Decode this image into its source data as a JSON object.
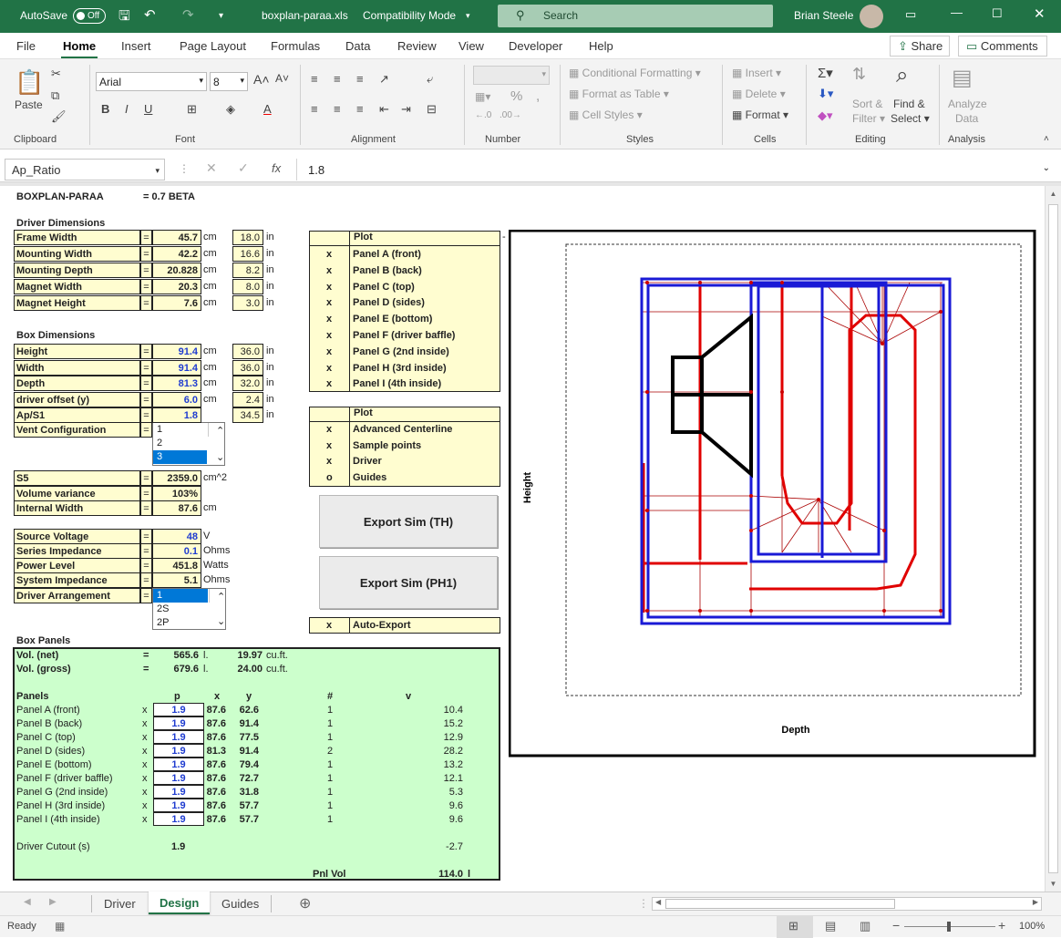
{
  "titlebar": {
    "autosave": "AutoSave",
    "autosave_state": "Off",
    "filename": "boxplan-paraa.xls",
    "mode": "Compatibility Mode",
    "search": "Search",
    "user": "Brian Steele"
  },
  "tabs": [
    "File",
    "Home",
    "Insert",
    "Page Layout",
    "Formulas",
    "Data",
    "Review",
    "View",
    "Developer",
    "Help"
  ],
  "share": "Share",
  "comments": "Comments",
  "ribbon": {
    "paste": "Paste",
    "clipboard": "Clipboard",
    "font_name": "Arial",
    "font_size": "8",
    "font": "Font",
    "alignment": "Alignment",
    "number": "Number",
    "cond_fmt": "Conditional Formatting",
    "fmt_table": "Format as Table",
    "cell_styles": "Cell Styles",
    "styles": "Styles",
    "insert": "Insert",
    "delete": "Delete",
    "format": "Format",
    "cells": "Cells",
    "sort1": "Sort &",
    "sort2": "Filter",
    "find1": "Find &",
    "find2": "Select",
    "editing": "Editing",
    "analyze1": "Analyze",
    "analyze2": "Data",
    "analysis": "Analysis"
  },
  "formula": {
    "namebox": "Ap_Ratio",
    "fx": "fx",
    "value": "1.8"
  },
  "sheet": {
    "title": "BOXPLAN-PARAA",
    "version": "=  0.7 BETA",
    "driver_dims_title": "Driver Dimensions",
    "driver_dims": [
      {
        "label": "Frame Width",
        "eq": "=",
        "val": "45.7",
        "unit": "cm",
        "in": "18.0",
        "inu": "in"
      },
      {
        "label": "Mounting Width",
        "eq": "=",
        "val": "42.2",
        "unit": "cm",
        "in": "16.6",
        "inu": "in"
      },
      {
        "label": "Mounting Depth",
        "eq": "=",
        "val": "20.828",
        "unit": "cm",
        "in": "8.2",
        "inu": "in"
      },
      {
        "label": "Magnet Width",
        "eq": "=",
        "val": "20.3",
        "unit": "cm",
        "in": "8.0",
        "inu": "in"
      },
      {
        "label": "Magnet Height",
        "eq": "=",
        "val": "7.6",
        "unit": "cm",
        "in": "3.0",
        "inu": "in"
      }
    ],
    "box_dims_title": "Box Dimensions",
    "box_dims": [
      {
        "label": "Height",
        "eq": "=",
        "val": "91.4",
        "unit": "cm",
        "in": "36.0",
        "inu": "in"
      },
      {
        "label": "Width",
        "eq": "=",
        "val": "91.4",
        "unit": "cm",
        "in": "36.0",
        "inu": "in"
      },
      {
        "label": "Depth",
        "eq": "=",
        "val": "81.3",
        "unit": "cm",
        "in": "32.0",
        "inu": "in"
      },
      {
        "label": "driver offset (y)",
        "eq": "=",
        "val": "6.0",
        "unit": "cm",
        "in": "2.4",
        "inu": "in"
      },
      {
        "label": "Ap/S1",
        "eq": "=",
        "val": "1.8",
        "unit": "",
        "in": "34.5",
        "inu": "in"
      }
    ],
    "vent_label": "Vent Configuration",
    "vent_eq": "=",
    "vent_options": [
      "1",
      "2",
      "3"
    ],
    "s5": [
      {
        "label": "S5",
        "eq": "=",
        "val": "2359.0",
        "unit": "cm^2"
      },
      {
        "label": "Volume variance",
        "eq": "=",
        "val": "103%",
        "unit": ""
      },
      {
        "label": "Internal Width",
        "eq": "=",
        "val": "87.6",
        "unit": "cm"
      }
    ],
    "power": [
      {
        "label": "Source Voltage",
        "eq": "=",
        "val": "48",
        "unit": "V"
      },
      {
        "label": "Series Impedance",
        "eq": "=",
        "val": "0.1",
        "unit": "Ohms"
      },
      {
        "label": "Power Level",
        "eq": "=",
        "val": "451.8",
        "unit": "Watts"
      },
      {
        "label": "System Impedance",
        "eq": "=",
        "val": "5.1",
        "unit": "Ohms"
      }
    ],
    "arr_label": "Driver Arrangement",
    "arr_eq": "=",
    "arr_options": [
      "1",
      "2S",
      "2P"
    ],
    "plot1_title": "Plot",
    "plot1": [
      {
        "m": "x",
        "l": "Panel A (front)"
      },
      {
        "m": "x",
        "l": "Panel B (back)"
      },
      {
        "m": "x",
        "l": "Panel C (top)"
      },
      {
        "m": "x",
        "l": "Panel D (sides)"
      },
      {
        "m": "x",
        "l": "Panel E (bottom)"
      },
      {
        "m": "x",
        "l": "Panel F (driver baffle)"
      },
      {
        "m": "x",
        "l": "Panel G (2nd inside)"
      },
      {
        "m": "x",
        "l": "Panel H (3rd inside)"
      },
      {
        "m": "x",
        "l": "Panel I (4th inside)"
      }
    ],
    "plot2_title": "Plot",
    "plot2": [
      {
        "m": "x",
        "l": "Advanced Centerline"
      },
      {
        "m": "x",
        "l": "Sample points"
      },
      {
        "m": "x",
        "l": "Driver"
      },
      {
        "m": "o",
        "l": "Guides"
      }
    ],
    "btn_th": "Export Sim (TH)",
    "btn_ph1": "Export Sim (PH1)",
    "auto_m": "x",
    "auto_l": "Auto-Export",
    "panels_title": "Box Panels",
    "vol_net": {
      "label": "Vol. (net)",
      "eq": "=",
      "l": "565.6",
      "lu": "l.",
      "ft": "19.97",
      "ftu": "cu.ft."
    },
    "vol_gross": {
      "label": "Vol. (gross)",
      "eq": "=",
      "l": "679.6",
      "lu": "l.",
      "ft": "24.00",
      "ftu": "cu.ft."
    },
    "ph": {
      "panels": "Panels",
      "p": "p",
      "x": "x",
      "y": "y",
      "n": "#",
      "v": "v"
    },
    "panels": [
      {
        "n": "Panel A (front)",
        "m": "x",
        "p": "1.9",
        "x": "87.6",
        "y": "62.6",
        "c": "1",
        "v": "10.4"
      },
      {
        "n": "Panel B (back)",
        "m": "x",
        "p": "1.9",
        "x": "87.6",
        "y": "91.4",
        "c": "1",
        "v": "15.2"
      },
      {
        "n": "Panel C (top)",
        "m": "x",
        "p": "1.9",
        "x": "87.6",
        "y": "77.5",
        "c": "1",
        "v": "12.9"
      },
      {
        "n": "Panel D (sides)",
        "m": "x",
        "p": "1.9",
        "x": "81.3",
        "y": "91.4",
        "c": "2",
        "v": "28.2"
      },
      {
        "n": "Panel E (bottom)",
        "m": "x",
        "p": "1.9",
        "x": "87.6",
        "y": "79.4",
        "c": "1",
        "v": "13.2"
      },
      {
        "n": "Panel F (driver baffle)",
        "m": "x",
        "p": "1.9",
        "x": "87.6",
        "y": "72.7",
        "c": "1",
        "v": "12.1"
      },
      {
        "n": "Panel G (2nd inside)",
        "m": "x",
        "p": "1.9",
        "x": "87.6",
        "y": "31.8",
        "c": "1",
        "v": "5.3"
      },
      {
        "n": "Panel H (3rd inside)",
        "m": "x",
        "p": "1.9",
        "x": "87.6",
        "y": "57.7",
        "c": "1",
        "v": "9.6"
      },
      {
        "n": "Panel I (4th inside)",
        "m": "x",
        "p": "1.9",
        "x": "87.6",
        "y": "57.7",
        "c": "1",
        "v": "9.6"
      }
    ],
    "cutout_label": "Driver Cutout (s)",
    "cutout_p": "1.9",
    "cutout_v": "-2.7",
    "pnl_label": "Pnl Vol",
    "pnl_val": "114.0",
    "pnl_unit": "l",
    "dash": "-",
    "chart_ylabel": "Height",
    "chart_xlabel": "Depth"
  },
  "sheet_tabs": [
    "Driver",
    "Design",
    "Guides"
  ],
  "status": {
    "ready": "Ready",
    "zoom": "100%"
  }
}
